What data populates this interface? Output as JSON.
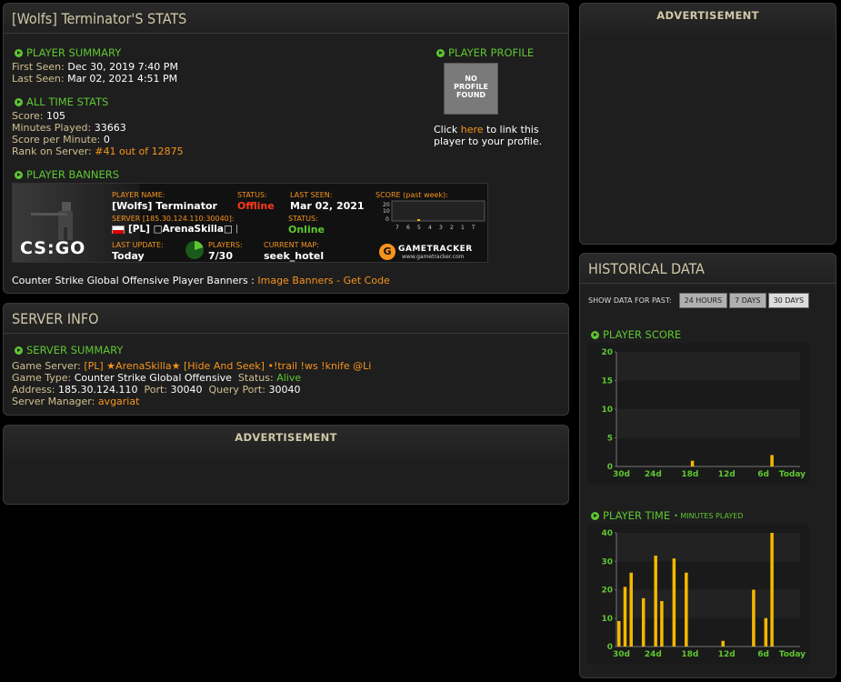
{
  "page_title": "[Wolfs] Terminator'S STATS",
  "player_summary": {
    "heading": "PLAYER SUMMARY",
    "first_seen_label": "First Seen:",
    "first_seen": "Dec 30, 2019 7:40 PM",
    "last_seen_label": "Last Seen:",
    "last_seen": "Mar 02, 2021 4:51 PM"
  },
  "all_time": {
    "heading": "ALL TIME STATS",
    "score_label": "Score:",
    "score": "105",
    "minutes_label": "Minutes Played:",
    "minutes": "33663",
    "spm_label": "Score per Minute:",
    "spm": "0",
    "rank_label": "Rank on Server:",
    "rank": "#41 out of 12875"
  },
  "profile": {
    "heading": "PLAYER PROFILE",
    "no_profile": [
      "NO",
      "PROFILE",
      "FOUND"
    ],
    "click": "Click",
    "here": "here",
    "rest1": "to link this",
    "rest2": "player to your profile."
  },
  "banners": {
    "heading": "PLAYER BANNERS",
    "footer_text": "Counter Strike Global Offensive Player Banners :",
    "image_banners": "Image Banners",
    "sep": "-",
    "get_code": "Get Code"
  },
  "banner": {
    "player_name_label": "PLAYER NAME:",
    "player_name": "[Wolfs] Terminator",
    "status_label": "STATUS:",
    "status": "Offline",
    "last_seen_label": "LAST SEEN:",
    "last_seen": "Mar 02, 2021",
    "score_label": "SCORE (past week):",
    "server_label": "SERVER [185.30.124.110:30040]:",
    "server": "[PL] □ArenaSkilla□ [Hide And S...",
    "server_status_label": "STATUS:",
    "server_status": "Online",
    "last_update_label": "LAST UPDATE:",
    "last_update": "Today",
    "players_label": "PLAYERS:",
    "players": "7/30",
    "map_label": "CURRENT MAP:",
    "map": "seek_hotel",
    "game_logo": "CS:GO",
    "brand": "GAMETRACKER",
    "brand_url": "www.gametracker.com",
    "mini_y": [
      "20",
      "10",
      "0"
    ],
    "mini_x": [
      "7",
      "6",
      "5",
      "4",
      "3",
      "2",
      "1",
      "T"
    ]
  },
  "server_info": {
    "title": "SERVER INFO",
    "heading": "SERVER SUMMARY",
    "game_server_label": "Game Server:",
    "game_server": "[PL] ★ArenaSkilla★ [Hide And Seek] •!trail !ws !knife @Li",
    "game_type_label": "Game Type:",
    "game_type": "Counter Strike Global Offensive",
    "status_label": "Status:",
    "status": "Alive",
    "address_label": "Address:",
    "address": "185.30.124.110",
    "port_label": "Port:",
    "port": "30040",
    "qport_label": "Query Port:",
    "qport": "30040",
    "manager_label": "Server Manager:",
    "manager": "avgariat"
  },
  "ads": {
    "label": "ADVERTISEMENT"
  },
  "historical": {
    "title": "HISTORICAL DATA",
    "show_label": "SHOW DATA FOR PAST:",
    "buttons": [
      "24 HOURS",
      "7 DAYS",
      "30 DAYS"
    ],
    "score_heading": "PLAYER SCORE",
    "time_heading": "PLAYER TIME",
    "time_sub": "• MINUTES PLAYED"
  },
  "colors": {
    "accent": "#f7941d",
    "green": "#5ec632",
    "bar": "#f5b800"
  },
  "chart_data": [
    {
      "type": "bar",
      "title": "PLAYER SCORE",
      "x_tick_labels": [
        "30d",
        "24d",
        "18d",
        "12d",
        "6d",
        "Today"
      ],
      "y_ticks": [
        0,
        5,
        10,
        15,
        20
      ],
      "ylim": [
        0,
        20
      ],
      "days_ago": [
        18,
        5
      ],
      "values": [
        1,
        2
      ]
    },
    {
      "type": "bar",
      "title": "PLAYER TIME",
      "x_tick_labels": [
        "30d",
        "24d",
        "18d",
        "12d",
        "6d",
        "Today"
      ],
      "y_ticks": [
        0,
        10,
        20,
        30,
        40
      ],
      "ylim": [
        0,
        40
      ],
      "days_ago": [
        30,
        29,
        28,
        26,
        24,
        23,
        21,
        19,
        13,
        8,
        6,
        5
      ],
      "values": [
        9,
        21,
        26,
        17,
        32,
        16,
        31,
        26,
        2,
        20,
        10,
        40
      ]
    }
  ]
}
